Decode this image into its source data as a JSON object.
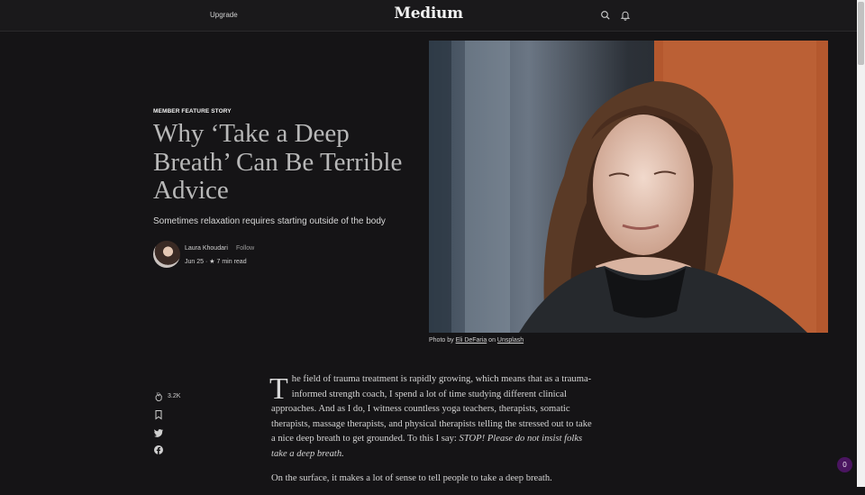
{
  "header": {
    "upgrade_label": "Upgrade",
    "logo_text": "Medium",
    "icons": [
      "search-icon",
      "bell-icon"
    ]
  },
  "story": {
    "kicker": "MEMBER FEATURE STORY",
    "title": "Why ‘Take a Deep Breath’ Can Be Terrible Advice",
    "subtitle": "Sometimes relaxation requires starting outside of the body",
    "author": "Laura Khoudari",
    "follow_label": "Follow",
    "date": "Jun 25",
    "separator": "·",
    "star": "★",
    "read_time": "7 min read"
  },
  "image": {
    "caption_prefix": "Photo by",
    "photographer": "Eli DeFaria",
    "caption_on": "on",
    "source": "Unsplash"
  },
  "actions": {
    "clap_count": "3.2K",
    "icons": [
      "clap-icon",
      "bookmark-icon",
      "twitter-icon",
      "facebook-icon"
    ]
  },
  "article": {
    "dropcap": "T",
    "p1_rest": "he field of trauma treatment is rapidly growing, which means that as a trauma-informed strength coach, I spend a lot of time studying different clinical approaches. And as I do, I witness countless yoga teachers, therapists, somatic therapists, massage therapists, and physical therapists telling the stressed out to take a nice deep breath to get grounded. To this I say:",
    "p1_emphasis": "STOP! Please do not insist folks take a deep breath.",
    "p2": "On the surface, it makes a lot of sense to tell people to take a deep breath."
  },
  "notification_badge": "0",
  "colors": {
    "background": "#151416",
    "headline": "#b8b8b8",
    "badge": "#4a1560"
  }
}
